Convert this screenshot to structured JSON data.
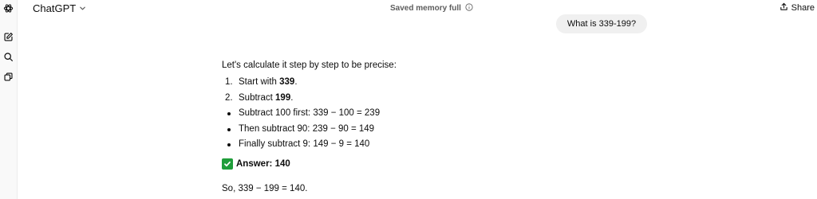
{
  "sidebar": {
    "items": [
      {
        "icon": "openai-logo-icon"
      },
      {
        "icon": "new-chat-icon"
      },
      {
        "icon": "search-icon"
      },
      {
        "icon": "library-icon"
      }
    ]
  },
  "header": {
    "model_name": "ChatGPT",
    "memory_status": "Saved memory full",
    "share_label": "Share"
  },
  "conversation": {
    "user_message": "What is 339-199?",
    "assistant": {
      "intro": "Let's calculate it step by step to be precise:",
      "numbered_steps": [
        {
          "marker": "1.",
          "prefix": "Start with ",
          "bold": "339",
          "suffix": "."
        },
        {
          "marker": "2.",
          "prefix": "Subtract ",
          "bold": "199",
          "suffix": "."
        }
      ],
      "bullet_steps": [
        "Subtract 100 first: 339 − 100 = 239",
        "Then subtract 90: 239 − 90 = 149",
        "Finally subtract 9: 149 − 9 = 140"
      ],
      "answer_label": "Answer: 140",
      "closing": "So, 339 − 199 = 140."
    }
  },
  "colors": {
    "sidebar_bg": "#f9f9f9",
    "bubble_bg": "#f0f0f0",
    "check_green": "#1f9d3a"
  }
}
